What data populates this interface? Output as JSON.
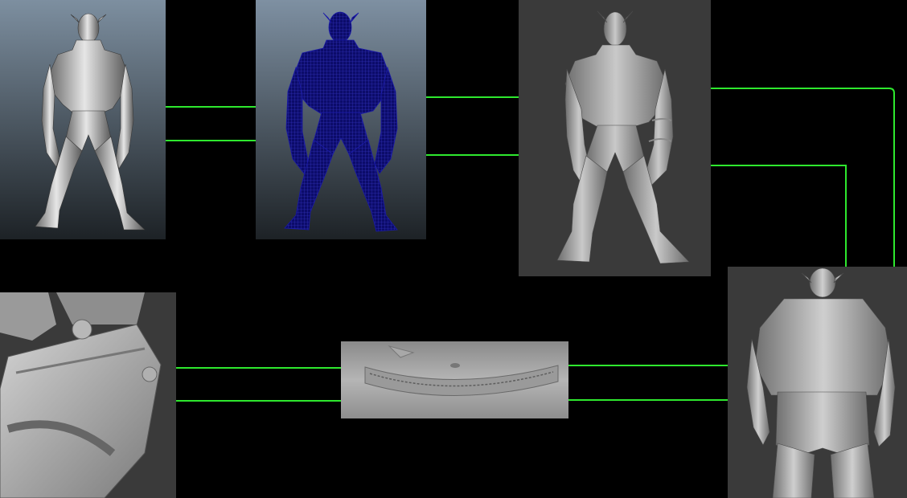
{
  "colors": {
    "background": "#000000",
    "connector": "#2ee82e",
    "maya_bg_top": "#7d8fa0",
    "maya_bg_bottom": "#1d2226",
    "wireframe": "#1a1aa8",
    "zbrush_bg": "#3a3a3a",
    "clay": "#b9b9b9"
  },
  "panels": [
    {
      "id": "maya-smooth-render",
      "kind": "render",
      "subject": "full-body-front",
      "style": "smooth-shaded"
    },
    {
      "id": "maya-wireframe-render",
      "kind": "render",
      "subject": "full-body-front",
      "style": "wireframe"
    },
    {
      "id": "zbrush-sculpt-front",
      "kind": "render",
      "subject": "full-body-front",
      "style": "sculpted"
    },
    {
      "id": "zbrush-sculpt-back",
      "kind": "render",
      "subject": "full-body-back",
      "style": "sculpted"
    },
    {
      "id": "zbrush-arm-bracer-closeup",
      "kind": "render",
      "subject": "forearm-bracer",
      "style": "sculpted"
    },
    {
      "id": "zbrush-waist-seam-closeup",
      "kind": "render",
      "subject": "waist-seam",
      "style": "sculpted"
    }
  ]
}
